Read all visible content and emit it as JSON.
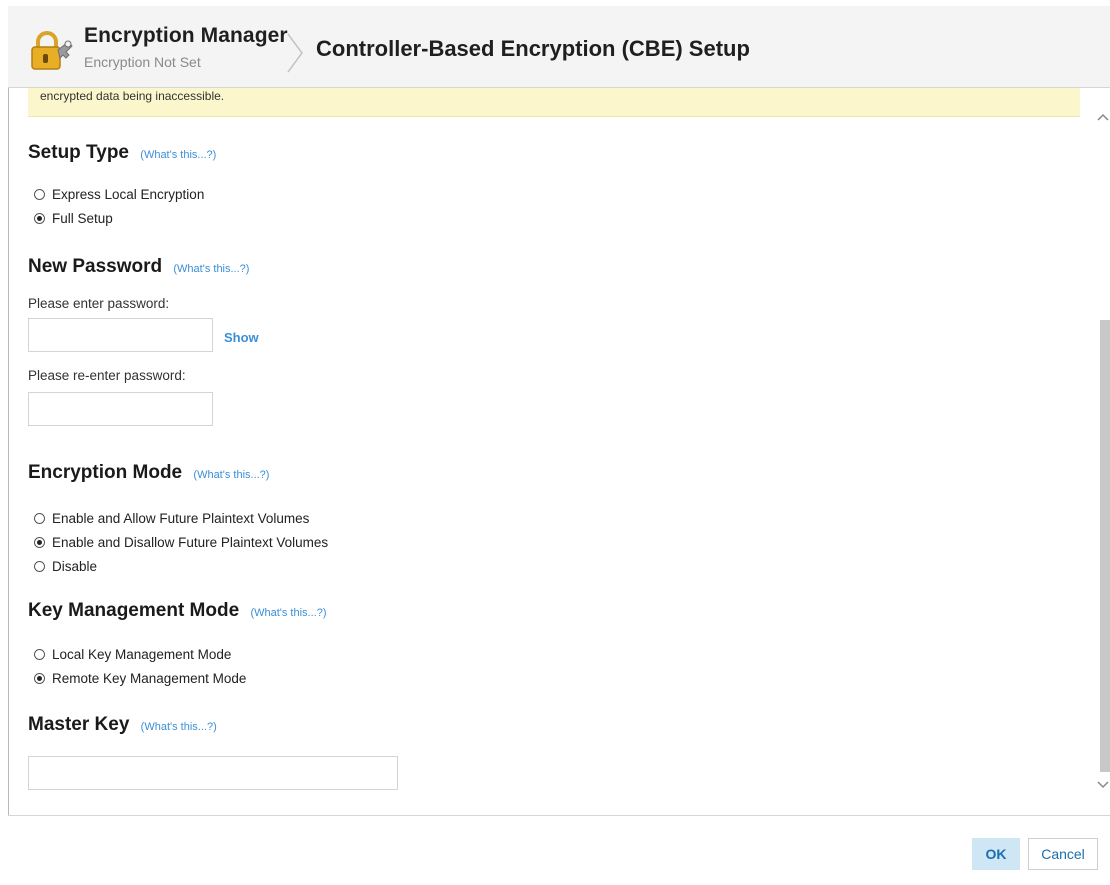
{
  "header": {
    "app_title": "Encryption Manager",
    "app_subtitle": "Encryption Not Set",
    "page_title": "Controller-Based Encryption (CBE) Setup"
  },
  "warning": {
    "text": "encrypted data being inaccessible."
  },
  "whats_this": "(What's this...?)",
  "setup_type": {
    "title": "Setup Type",
    "options": [
      {
        "label": "Express Local Encryption",
        "checked": false
      },
      {
        "label": "Full Setup",
        "checked": true
      }
    ]
  },
  "new_password": {
    "title": "New Password",
    "enter_label": "Please enter password:",
    "reenter_label": "Please re-enter password:",
    "password_value": "",
    "reenter_value": "",
    "show_label": "Show"
  },
  "encryption_mode": {
    "title": "Encryption Mode",
    "options": [
      {
        "label": "Enable and Allow Future Plaintext Volumes",
        "checked": false
      },
      {
        "label": "Enable and Disallow Future Plaintext Volumes",
        "checked": true
      },
      {
        "label": "Disable",
        "checked": false
      }
    ]
  },
  "key_management_mode": {
    "title": "Key Management Mode",
    "options": [
      {
        "label": "Local Key Management Mode",
        "checked": false
      },
      {
        "label": "Remote Key Management Mode",
        "checked": true
      }
    ]
  },
  "master_key": {
    "title": "Master Key",
    "value": ""
  },
  "footer": {
    "ok_label": "OK",
    "cancel_label": "Cancel"
  },
  "icons": {
    "lock": "lock-icon",
    "breadcrumb_separator": "chevron-right-icon",
    "scroll_up": "chevron-up-icon",
    "scroll_down": "chevron-down-icon"
  },
  "colors": {
    "link": "#3b8fd6",
    "warning_bg": "#fbf6cc",
    "ok_bg": "#cfe6f5",
    "lock_gold": "#e0a520"
  }
}
